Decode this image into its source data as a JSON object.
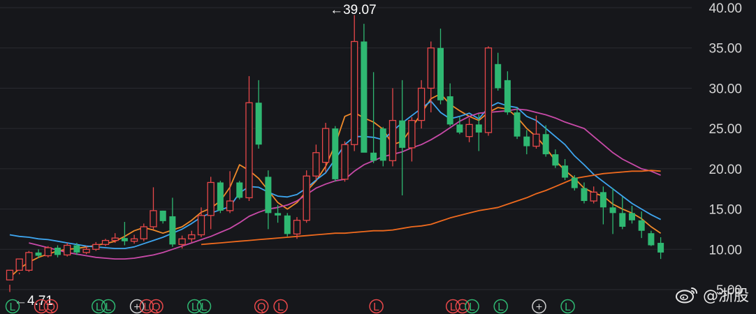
{
  "chart_data": {
    "type": "candlestick",
    "title": "",
    "xlabel": "",
    "ylabel": "",
    "ylim": [
      5,
      40
    ],
    "y_ticks": [
      "40.00",
      "35.00",
      "30.00",
      "25.00",
      "20.00",
      "15.00",
      "10.00",
      "5.00"
    ],
    "grid": "horizontal",
    "colors": {
      "up": "#e8484a",
      "down": "#2fb872",
      "background": "#16171b"
    },
    "annotations": [
      {
        "label": "39.07",
        "price": 39.07,
        "bar": 33
      },
      {
        "label": "4.71",
        "price": 4.71,
        "bar": 0
      }
    ],
    "candles": [
      [
        6.2,
        7.4,
        5.6,
        4.7
      ],
      [
        7.4,
        8.8,
        6.9,
        7.1
      ],
      [
        7.4,
        9.6,
        9.8,
        7.2
      ],
      [
        9.6,
        9.2,
        10.0,
        8.9
      ],
      [
        9.2,
        10.2,
        10.4,
        9.0
      ],
      [
        10.2,
        9.3,
        10.5,
        9.0
      ],
      [
        9.3,
        10.5,
        10.8,
        9.1
      ],
      [
        10.5,
        9.6,
        10.8,
        9.3
      ],
      [
        9.6,
        10.0,
        10.4,
        9.4
      ],
      [
        10.0,
        10.6,
        10.9,
        9.8
      ],
      [
        10.6,
        11.1,
        11.3,
        10.4
      ],
      [
        11.1,
        11.4,
        12.0,
        10.8
      ],
      [
        11.4,
        11.0,
        13.4,
        10.5
      ],
      [
        11.0,
        11.3,
        11.8,
        10.7
      ],
      [
        11.3,
        12.8,
        13.2,
        11.0
      ],
      [
        12.8,
        14.8,
        17.7,
        12.5
      ],
      [
        14.8,
        13.5,
        14.8,
        13.2
      ],
      [
        14.1,
        10.6,
        16.4,
        10.3
      ],
      [
        10.6,
        11.3,
        11.7,
        10.1
      ],
      [
        11.3,
        11.8,
        12.3,
        10.9
      ],
      [
        11.8,
        14.2,
        15.2,
        11.5
      ],
      [
        14.2,
        18.3,
        19.0,
        12.5
      ],
      [
        18.3,
        14.8,
        18.5,
        14.5
      ],
      [
        14.8,
        16.0,
        19.7,
        14.5
      ],
      [
        18.3,
        16.4,
        18.5,
        16.2
      ],
      [
        16.4,
        28.2,
        31.5,
        16.0
      ],
      [
        28.2,
        23.0,
        31.0,
        22.5
      ],
      [
        19.0,
        14.5,
        19.8,
        12.5
      ],
      [
        14.5,
        14.2,
        15.5,
        13.3
      ],
      [
        14.2,
        11.9,
        14.5,
        11.6
      ],
      [
        11.9,
        13.6,
        14.0,
        11.3
      ],
      [
        13.6,
        19.1,
        19.8,
        13.3
      ],
      [
        19.1,
        22.0,
        23.0,
        18.6
      ],
      [
        20.8,
        25.0,
        25.7,
        19.6
      ],
      [
        25.0,
        18.7,
        25.3,
        18.4
      ],
      [
        18.7,
        23.0,
        23.4,
        18.4
      ],
      [
        23.0,
        35.8,
        39.07,
        22.2
      ],
      [
        35.8,
        22.0,
        38.0,
        22.2
      ],
      [
        22.0,
        21.0,
        32.0,
        20.7
      ],
      [
        25.0,
        21.0,
        25.2,
        20.3
      ],
      [
        21.0,
        26.0,
        30.0,
        20.3
      ],
      [
        26.0,
        22.6,
        31.0,
        16.7
      ],
      [
        22.6,
        26.0,
        26.4,
        20.9
      ],
      [
        26.0,
        30.0,
        31.0,
        25.0
      ],
      [
        30.0,
        35.0,
        35.8,
        27.0
      ],
      [
        35.0,
        28.5,
        37.4,
        28.0
      ],
      [
        29.0,
        25.5,
        30.6,
        25.3
      ],
      [
        25.5,
        24.5,
        26.4,
        24.3
      ],
      [
        24.0,
        25.5,
        26.3,
        23.3
      ],
      [
        25.5,
        24.5,
        26.8,
        22.2
      ],
      [
        24.5,
        35.0,
        35.2,
        24.1
      ],
      [
        33.0,
        30.0,
        34.4,
        29.7
      ],
      [
        31.0,
        27.0,
        32.1,
        26.7
      ],
      [
        27.0,
        24.0,
        27.6,
        23.7
      ],
      [
        24.0,
        22.8,
        24.8,
        21.8
      ],
      [
        22.8,
        24.3,
        26.6,
        22.5
      ],
      [
        24.3,
        21.8,
        25.4,
        21.5
      ],
      [
        21.8,
        20.4,
        22.4,
        20.1
      ],
      [
        20.4,
        18.9,
        21.2,
        18.6
      ],
      [
        18.9,
        17.6,
        19.2,
        17.3
      ],
      [
        17.6,
        16.0,
        18.3,
        15.7
      ],
      [
        16.0,
        17.1,
        17.8,
        15.7
      ],
      [
        17.1,
        15.2,
        17.8,
        13.1
      ],
      [
        15.2,
        14.5,
        17.6,
        11.9
      ],
      [
        14.5,
        12.8,
        16.5,
        12.5
      ],
      [
        14.5,
        13.6,
        15.4,
        13.2
      ],
      [
        13.6,
        12.3,
        14.7,
        11.4
      ],
      [
        12.0,
        10.5,
        12.3,
        10.4
      ],
      [
        10.8,
        9.6,
        11.5,
        8.8
      ]
    ],
    "moving_averages": [
      {
        "color": "#f08a2a",
        "values": [
          6.5,
          7.6,
          8.4,
          9.0,
          9.4,
          9.8,
          10.0,
          10.1,
          10.3,
          10.5,
          10.7,
          11.0,
          11.6,
          12.3,
          12.7,
          12.4,
          12.0,
          12.4,
          12.8,
          13.6,
          14.6,
          15.1,
          16.0,
          17.7,
          20.5,
          19.8,
          18.8,
          17.3,
          15.8,
          15.0,
          15.8,
          17.2,
          18.5,
          20.3,
          23.0,
          26.5,
          27.0,
          26.3,
          25.8,
          24.9,
          23.0,
          23.4,
          25.1,
          26.9,
          28.7,
          29.3,
          28.0,
          27.2,
          26.5,
          26.0,
          27.0,
          27.6,
          27.4,
          26.4,
          25.0,
          24.0,
          22.6,
          21.0,
          19.8,
          18.8,
          17.6,
          17.0,
          16.6,
          15.6,
          15.0,
          14.5,
          13.8,
          12.8,
          12.0
        ]
      },
      {
        "color": "#3ea6f0",
        "values": [
          11.8,
          11.6,
          11.5,
          11.3,
          11.2,
          11.0,
          10.8,
          10.6,
          10.4,
          10.3,
          10.2,
          10.1,
          10.1,
          10.3,
          10.7,
          11.1,
          11.5,
          12.0,
          12.5,
          13.2,
          14.0,
          14.5,
          14.9,
          15.3,
          17.0,
          17.8,
          17.7,
          17.1,
          16.6,
          16.5,
          16.8,
          17.6,
          18.6,
          19.5,
          21.2,
          23.0,
          24.0,
          24.0,
          23.9,
          23.6,
          24.7,
          25.7,
          26.6,
          27.5,
          28.4,
          27.0,
          26.2,
          26.5,
          26.9,
          26.2,
          27.6,
          28.2,
          27.8,
          27.6,
          26.5,
          26.0,
          25.0,
          24.0,
          23.0,
          21.6,
          20.5,
          19.3,
          18.4,
          17.5,
          16.6,
          15.7,
          15.0,
          14.3,
          13.7
        ]
      },
      {
        "color": "#c84aa8",
        "values": [
          10.8,
          10.5,
          10.2,
          9.9,
          9.6,
          9.4,
          9.2,
          9.0,
          8.9,
          8.8,
          8.8,
          8.9,
          9.1,
          9.3,
          9.6,
          10.0,
          10.4,
          10.8,
          11.2,
          11.6,
          12.1,
          12.6,
          13.3,
          14.1,
          14.6,
          15.0,
          15.2,
          15.5,
          16.0,
          16.8,
          17.6,
          18.1,
          18.5,
          18.7,
          19.7,
          20.5,
          21.0,
          21.5,
          21.8,
          22.1,
          22.6,
          23.0,
          23.6,
          24.3,
          25.1,
          25.9,
          26.5,
          26.9,
          27.0,
          27.1,
          27.2,
          27.4,
          27.3,
          27.0,
          26.7,
          26.3,
          25.8,
          25.4,
          25.0,
          24.0,
          23.0,
          22.0,
          21.2,
          20.6,
          20.0,
          19.7,
          19.2
        ]
      },
      {
        "color": "#ef6a1e",
        "values": [
          10.6,
          10.7,
          10.8,
          10.9,
          11.0,
          11.1,
          11.2,
          11.3,
          11.4,
          11.5,
          11.6,
          11.7,
          11.8,
          11.9,
          12.0,
          12.0,
          12.1,
          12.2,
          12.3,
          12.3,
          12.4,
          12.6,
          12.8,
          12.9,
          13.1,
          13.5,
          13.9,
          14.2,
          14.5,
          14.8,
          15.0,
          15.2,
          15.6,
          16.0,
          16.4,
          16.9,
          17.3,
          17.8,
          18.3,
          18.8,
          19.0,
          19.2,
          19.4,
          19.5,
          19.6,
          19.7,
          19.7,
          19.8,
          19.7
        ]
      }
    ],
    "marker_labels": [
      {
        "text": "L",
        "bar": 0,
        "color": "#2fb872"
      },
      {
        "text": "L",
        "bar": 3,
        "color": "#e8484a"
      },
      {
        "text": "Q",
        "bar": 4,
        "color": "#e8484a"
      },
      {
        "text": "L",
        "bar": 9,
        "color": "#2fb872"
      },
      {
        "text": "L",
        "bar": 10,
        "color": "#2fb872"
      },
      {
        "text": "+",
        "bar": 13,
        "color": "#d0d0d0"
      },
      {
        "text": "L",
        "bar": 14,
        "color": "#e8484a"
      },
      {
        "text": "Q",
        "bar": 15,
        "color": "#e8484a"
      },
      {
        "text": "L",
        "bar": 19,
        "color": "#2fb872"
      },
      {
        "text": "L",
        "bar": 20,
        "color": "#2fb872"
      },
      {
        "text": "Q",
        "bar": 26,
        "color": "#e8484a"
      },
      {
        "text": "L",
        "bar": 28,
        "color": "#e8484a"
      },
      {
        "text": "L",
        "bar": 38,
        "color": "#e8484a"
      },
      {
        "text": "L",
        "bar": 46,
        "color": "#e8484a"
      },
      {
        "text": "C",
        "bar": 47,
        "color": "#e8484a"
      },
      {
        "text": "L",
        "bar": 48,
        "color": "#2fb872"
      },
      {
        "text": "L",
        "bar": 51,
        "color": "#2fb872"
      },
      {
        "text": "+",
        "bar": 55,
        "color": "#d0d0d0"
      },
      {
        "text": "L",
        "bar": 58,
        "color": "#2fb872"
      }
    ]
  },
  "watermark": {
    "text": "@浙股",
    "icon": "weibo-icon"
  }
}
